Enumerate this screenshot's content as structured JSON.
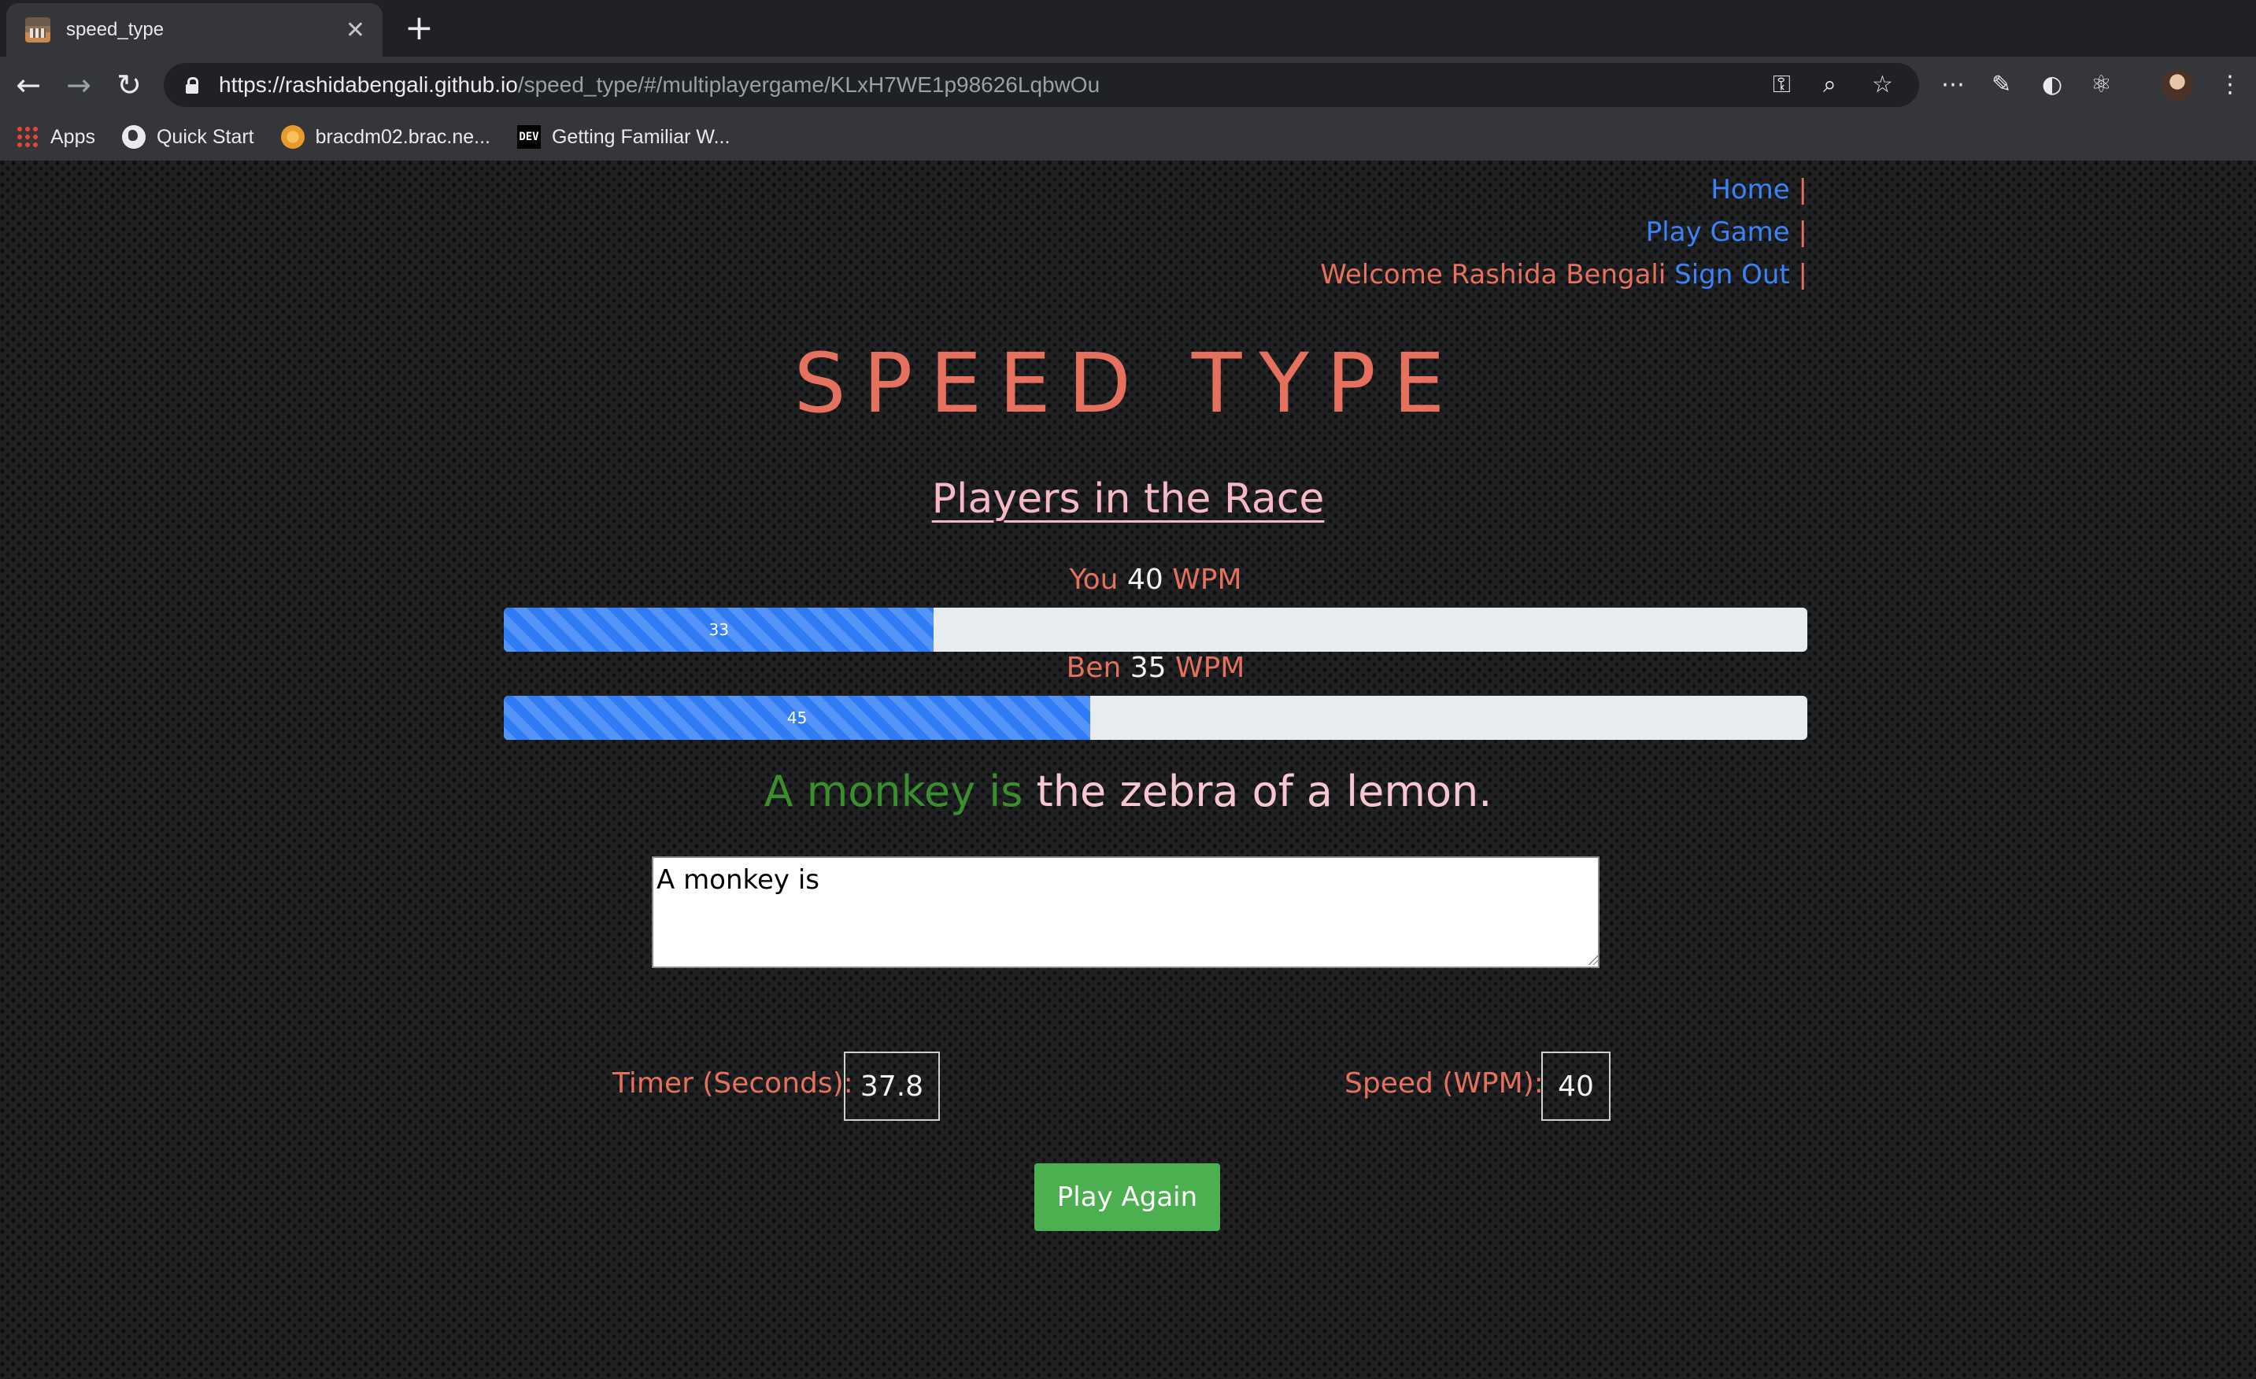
{
  "browser": {
    "tab_title": "speed_type",
    "url_host": "https://rashidabengali.github.io",
    "url_path": "/speed_type/#/multiplayergame/KLxH7WE1p98626LqbwOu",
    "bookmarks": [
      "Apps",
      "Quick Start",
      "bracdm02.brac.ne...",
      "Getting Familiar W..."
    ],
    "dev_badge": "DEV"
  },
  "nav": {
    "home": "Home",
    "play_game": "Play Game",
    "welcome": "Welcome Rashida Bengali",
    "sign_out": "Sign Out",
    "separator": "|"
  },
  "title": "SPEED TYPE",
  "subtitle": "Players in the Race",
  "players": [
    {
      "name": "You",
      "wpm": "40",
      "unit": "WPM",
      "progress": 33,
      "progress_label": "33"
    },
    {
      "name": "Ben",
      "wpm": "35",
      "unit": "WPM",
      "progress": 45,
      "progress_label": "45"
    }
  ],
  "quote": {
    "typed": "A monkey is",
    "remaining": "the zebra of a lemon."
  },
  "input_value": "A monkey is",
  "stats": {
    "timer_label": "Timer (Seconds):",
    "timer_value": "37.8",
    "speed_label": "Speed (WPM):",
    "speed_value": "40"
  },
  "play_again_label": "Play Again",
  "colors": {
    "accent_salmon": "#e5705d",
    "link_blue": "#3b82f6",
    "progress_blue": "#2f7cf6",
    "typed_green": "#3a8f2c",
    "button_green": "#4caf50"
  }
}
